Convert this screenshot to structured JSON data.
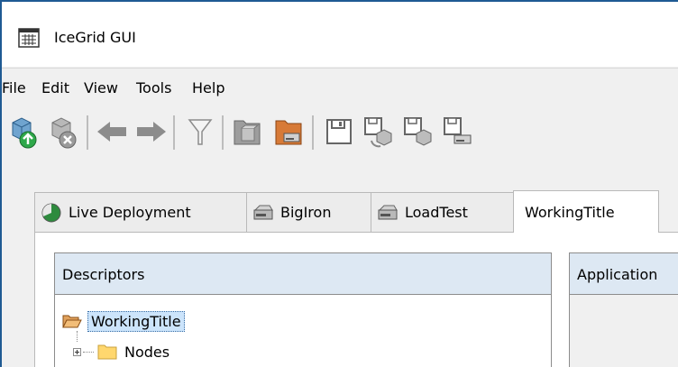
{
  "window": {
    "title": "IceGrid GUI",
    "icon": "grid-window-icon"
  },
  "menu": [
    "File",
    "Edit",
    "View",
    "Tools",
    "Help"
  ],
  "toolbar": {
    "buttons": [
      "connect-icon",
      "disconnect-icon",
      "back-arrow-icon",
      "forward-arrow-icon",
      "filter-icon",
      "open-application-icon",
      "open-from-file-icon",
      "save-icon",
      "save-to-registry-icon",
      "save-to-registry-no-restart-icon",
      "save-to-file-icon"
    ]
  },
  "tabs": [
    {
      "label": "Live Deployment",
      "icon": "live-deployment-icon"
    },
    {
      "label": "BigIron",
      "icon": "drive-icon"
    },
    {
      "label": "LoadTest",
      "icon": "drive-icon"
    },
    {
      "label": "WorkingTitle",
      "icon": "",
      "active": true
    }
  ],
  "descriptors_panel": {
    "title": "Descriptors",
    "tree": {
      "root": {
        "label": "WorkingTitle",
        "icon": "open-folder-icon",
        "selected": true
      },
      "children": [
        {
          "label": "Nodes",
          "icon": "folder-icon",
          "expander": "plus"
        }
      ]
    }
  },
  "application_panel": {
    "title": "Application"
  },
  "colors": {
    "window_border": "#1f5a93",
    "selection": "#cce4fb",
    "panel_header": "#dde8f3"
  }
}
